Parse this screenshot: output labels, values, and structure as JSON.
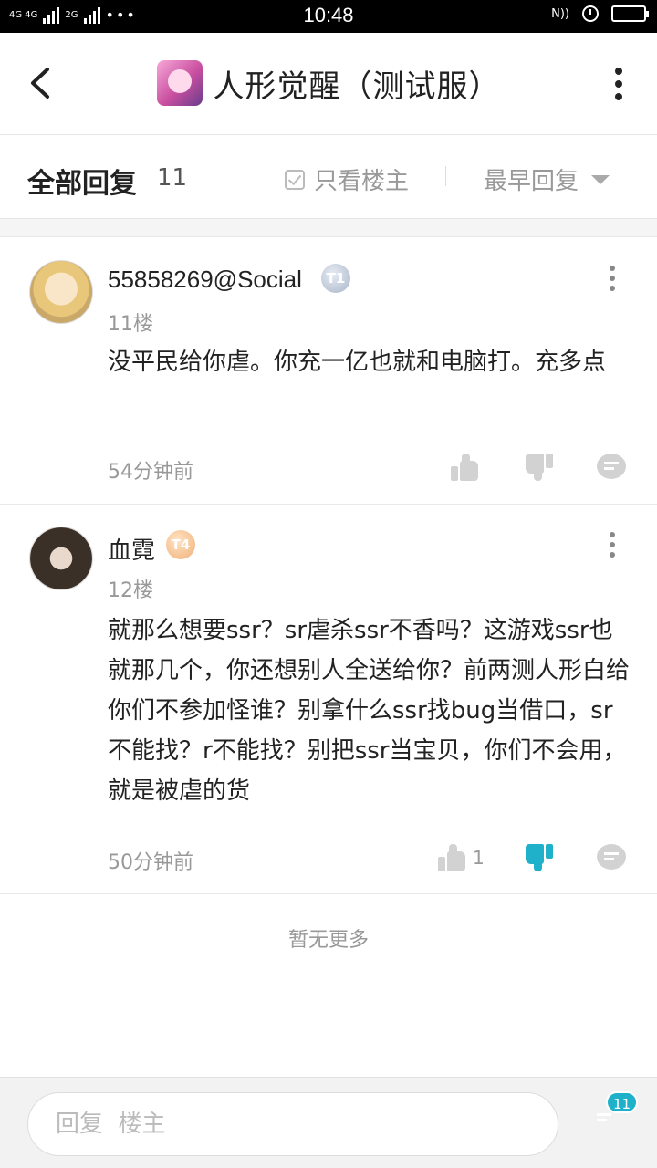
{
  "status_bar": {
    "network_left": "4G 4G",
    "network_right": "2G",
    "time": "10:48"
  },
  "header": {
    "title": "人形觉醒（测试服）",
    "back_icon": "back-arrow-icon",
    "more_icon": "more-vertical-icon"
  },
  "filter": {
    "all_replies_label": "全部回复",
    "reply_count": "11",
    "only_op_label": "只看楼主",
    "sort_label": "最早回复"
  },
  "comments": [
    {
      "username": "55858269@Social",
      "level": "T1",
      "floor": "11楼",
      "text": "没平民给你虐。你充一亿也就和电脑打。充多点",
      "time": "54分钟前",
      "likes": "",
      "disliked": false
    },
    {
      "username": "血霓",
      "level": "T4",
      "floor": "12楼",
      "text": "就那么想要ssr？sr虐杀ssr不香吗？这游戏ssr也就那几个，你还想别人全送给你？前两测人形白给你们不参加怪谁？别拿什么ssr找bug当借口，sr不能找？r不能找？别把ssr当宝贝，你们不会用，就是被虐的货",
      "time": "50分钟前",
      "likes": "1",
      "disliked": true
    }
  ],
  "footer": {
    "no_more": "暂无更多"
  },
  "bottom_bar": {
    "reply_placeholder": "回复  楼主",
    "comments_badge": "11"
  },
  "colors": {
    "accent": "#1fb1c9",
    "text": "#222222",
    "muted": "#999999"
  }
}
